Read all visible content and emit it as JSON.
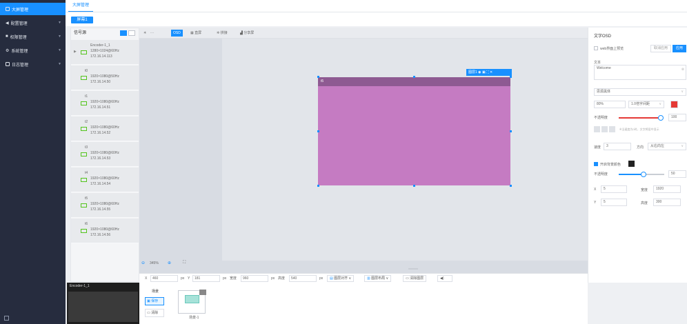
{
  "sidebar": {
    "items": [
      {
        "label": "大屏管理",
        "icon": "grid-icon"
      },
      {
        "label": "配置管理",
        "icon": "send-icon"
      },
      {
        "label": "权限管理",
        "icon": "lock-icon"
      },
      {
        "label": "系统管理",
        "icon": "gear-icon"
      },
      {
        "label": "日志管理",
        "icon": "log-icon"
      }
    ],
    "footer_icon": "grid-icon"
  },
  "topbar": {
    "tab": "大屏管理"
  },
  "subtab": {
    "label": "屏幕1"
  },
  "signal": {
    "title": "信号源",
    "items": [
      {
        "name": "Encoder-1_1",
        "res": "1280×1024@60Hz",
        "ip": "172.16.14.113"
      },
      {
        "name": "t0",
        "res": "1920×1080@50Hz",
        "ip": "172.16.14.50"
      },
      {
        "name": "t1",
        "res": "1920×1080@60Hz",
        "ip": "172.16.14.51"
      },
      {
        "name": "t2",
        "res": "1920×1080@60Hz",
        "ip": "172.16.14.52"
      },
      {
        "name": "t3",
        "res": "1920×1080@60Hz",
        "ip": "172.16.14.53"
      },
      {
        "name": "t4",
        "res": "1920×1080@60Hz",
        "ip": "172.16.14.54"
      },
      {
        "name": "t5",
        "res": "1920×1080@60Hz",
        "ip": "172.16.14.55"
      },
      {
        "name": "t6",
        "res": "1920×1080@60Hz",
        "ip": "172.16.14.56"
      }
    ]
  },
  "toolbar": {
    "osd": "OSD",
    "grid": "直屏",
    "wall": "拼接",
    "share": "分享屏"
  },
  "window": {
    "title": "t5",
    "tool_label": "图层1"
  },
  "zoom": {
    "value": "345%"
  },
  "bottom": {
    "x_label": "X",
    "x_value": "460",
    "y_label": "Y",
    "y_value": "181",
    "w_label": "宽度",
    "w_value": "960",
    "h_label": "高度",
    "h_value": "540",
    "unit": "px",
    "btn_layer": "图层对齐",
    "btn_layout": "图层布局",
    "btn_clear": "清除图层"
  },
  "preview": {
    "title": "Encoder-1_1"
  },
  "scenes": {
    "title": "场景",
    "save": "保存",
    "clear": "清除",
    "scene_name": "场景-1"
  },
  "props": {
    "title": "文字OSD",
    "web_preview": "web界面上预览",
    "btn_cancel": "取消应用",
    "btn_apply": "应用",
    "text_label": "文本",
    "text_value": "Welcome",
    "font": "思源黑体",
    "size": "80%",
    "spacing": "1.0倍字间距",
    "text_color": "#e53935",
    "opacity_label": "不透明度",
    "opacity_value": "100",
    "align_hint": "※当速度为0时，文字将居中显示",
    "speed_label": "速度",
    "speed_value": "3",
    "dir_label": "方向",
    "dir_value": "从右向左",
    "bg_label": "开启背景颜色",
    "bg_color": "#222222",
    "bg_opacity_label": "不透明度",
    "bg_opacity_value": "50",
    "x_label": "X",
    "x_value": "5",
    "w_label": "宽度",
    "w_value": "1920",
    "y_label": "Y",
    "y_value": "5",
    "h_label": "高度",
    "h_value": "300"
  }
}
